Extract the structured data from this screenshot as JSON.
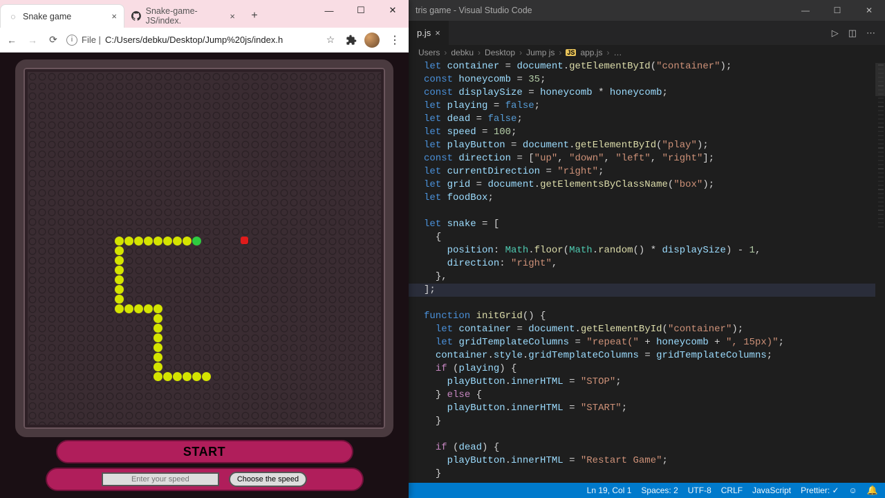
{
  "chrome": {
    "tabs": [
      {
        "title": "Snake game",
        "active": true,
        "favicon": "globe"
      },
      {
        "title": "Snake-game-JS/index.",
        "active": false,
        "favicon": "github"
      }
    ],
    "url_prefix": "File |",
    "url": "C:/Users/debku/Desktop/Jump%20js/index.h",
    "win": {
      "min": "—",
      "max": "☐",
      "close": "✕"
    }
  },
  "game": {
    "start_label": "START",
    "speed_placeholder": "Enter your speed",
    "choose_label": "Choose the speed",
    "board": {
      "cols": 35,
      "rows": 35,
      "cell": 14
    },
    "snake_cells": [
      [
        9,
        17
      ],
      [
        10,
        17
      ],
      [
        11,
        17
      ],
      [
        12,
        17
      ],
      [
        13,
        17
      ],
      [
        14,
        17
      ],
      [
        15,
        17
      ],
      [
        16,
        17
      ],
      [
        9,
        18
      ],
      [
        9,
        19
      ],
      [
        9,
        20
      ],
      [
        9,
        21
      ],
      [
        9,
        22
      ],
      [
        9,
        23
      ],
      [
        9,
        24
      ],
      [
        10,
        24
      ],
      [
        11,
        24
      ],
      [
        12,
        24
      ],
      [
        13,
        24
      ],
      [
        13,
        25
      ],
      [
        13,
        26
      ],
      [
        13,
        27
      ],
      [
        13,
        28
      ],
      [
        13,
        29
      ],
      [
        13,
        30
      ],
      [
        13,
        31
      ],
      [
        14,
        31
      ],
      [
        15,
        31
      ],
      [
        16,
        31
      ],
      [
        17,
        31
      ],
      [
        18,
        31
      ]
    ],
    "head": [
      17,
      17
    ],
    "food": [
      22,
      17
    ]
  },
  "vscode": {
    "title": "tris game - Visual Studio Code",
    "tab": "p.js",
    "breadcrumb": [
      "Users",
      "debku",
      "Desktop",
      "Jump js",
      "app.js",
      "…"
    ],
    "win": {
      "min": "—",
      "max": "☐",
      "close": "✕"
    },
    "status": {
      "line": "Ln 19, Col 1",
      "spaces": "Spaces: 2",
      "enc": "UTF-8",
      "eol": "CRLF",
      "lang": "JavaScript",
      "fmt": "Prettier: ✓",
      "smile": "☺",
      "bell": "🔔"
    }
  }
}
